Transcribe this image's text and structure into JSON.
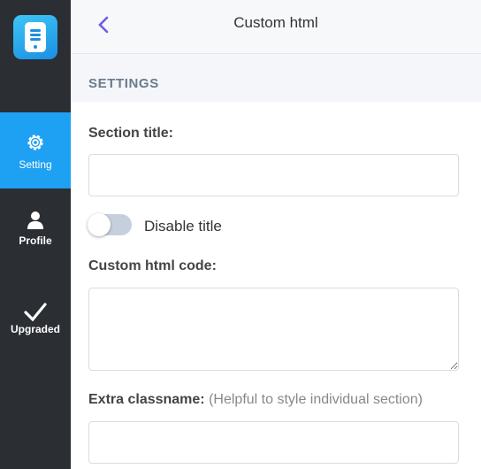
{
  "sidebar": {
    "logo": "document-app-icon",
    "items": [
      {
        "label": "Setting",
        "icon": "gear-icon",
        "active": true
      },
      {
        "label": "Profile",
        "icon": "user-icon",
        "active": false
      },
      {
        "label": "Upgraded",
        "icon": "checkmark-icon",
        "active": false
      }
    ]
  },
  "header": {
    "title": "Custom html",
    "back_icon": "chevron-left-icon"
  },
  "section": {
    "heading": "SETTINGS"
  },
  "form": {
    "section_title_label": "Section title:",
    "section_title_value": "",
    "disable_title_label": "Disable title",
    "disable_title_on": false,
    "custom_html_label": "Custom html code:",
    "custom_html_value": "",
    "extra_classname_label": "Extra classname:",
    "extra_classname_hint": "(Helpful to style individual section)",
    "extra_classname_value": ""
  },
  "colors": {
    "sidebar_bg": "#2b2e33",
    "active_bg": "#1ea1f2",
    "accent": "#6c5ce7",
    "toggle_off": "#c6d0dc"
  }
}
